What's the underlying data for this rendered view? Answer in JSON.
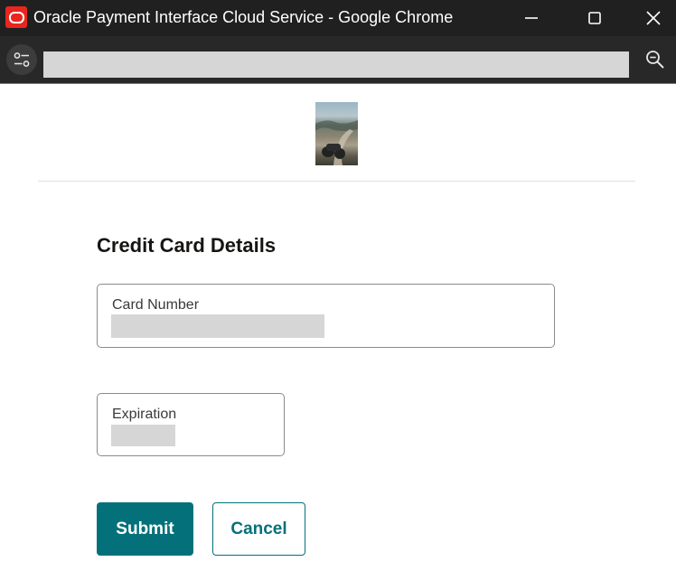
{
  "window": {
    "title": "Oracle Payment Interface Cloud Service - Google Chrome"
  },
  "browser": {
    "url": ""
  },
  "form": {
    "title": "Credit Card Details",
    "card_number": {
      "label": "Card Number",
      "value": ""
    },
    "expiration": {
      "label": "Expiration",
      "value": ""
    },
    "submit_label": "Submit",
    "cancel_label": "Cancel"
  },
  "colors": {
    "accent": "#04717a",
    "title_bar": "#202020",
    "app_icon": "#e8261e"
  },
  "icons": {
    "app": "oracle-icon",
    "minimize": "minimize-icon",
    "maximize": "maximize-icon",
    "close": "close-icon",
    "site_settings": "tune-icon",
    "zoom": "zoom-out-icon"
  }
}
